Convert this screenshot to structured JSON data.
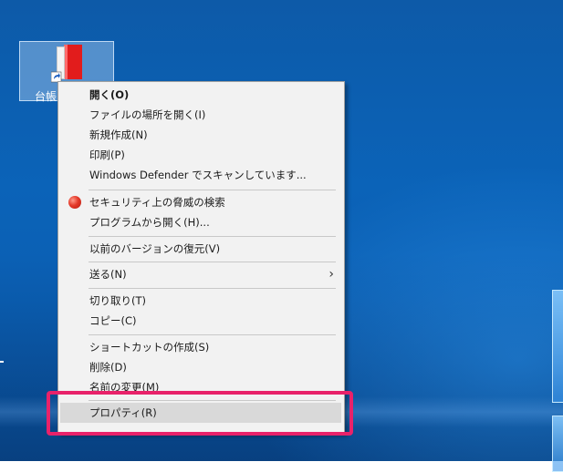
{
  "desktop": {
    "icon": {
      "label": "台帳",
      "icon_name": "red-book-shortcut-icon"
    }
  },
  "context_menu": {
    "items": [
      {
        "label": "開く(O)",
        "bold": true
      },
      {
        "label": "ファイルの場所を開く(I)"
      },
      {
        "label": "新規作成(N)"
      },
      {
        "label": "印刷(P)"
      },
      {
        "label": "Windows Defender でスキャンしています..."
      },
      {
        "label": "セキュリティ上の脅威の検索",
        "icon": "security-scan-icon"
      },
      {
        "label": "プログラムから開く(H)..."
      },
      {
        "label": "以前のバージョンの復元(V)"
      },
      {
        "label": "送る(N)",
        "submenu": true
      },
      {
        "label": "切り取り(T)"
      },
      {
        "label": "コピー(C)"
      },
      {
        "label": "ショートカットの作成(S)"
      },
      {
        "label": "削除(D)"
      },
      {
        "label": "名前の変更(M)"
      },
      {
        "label": "プロパティ(R)",
        "selected": true
      }
    ]
  },
  "colors": {
    "highlight_border": "#e8226a",
    "menu_background": "#f2f2f2",
    "desktop_blue": "#0b5fb3"
  }
}
